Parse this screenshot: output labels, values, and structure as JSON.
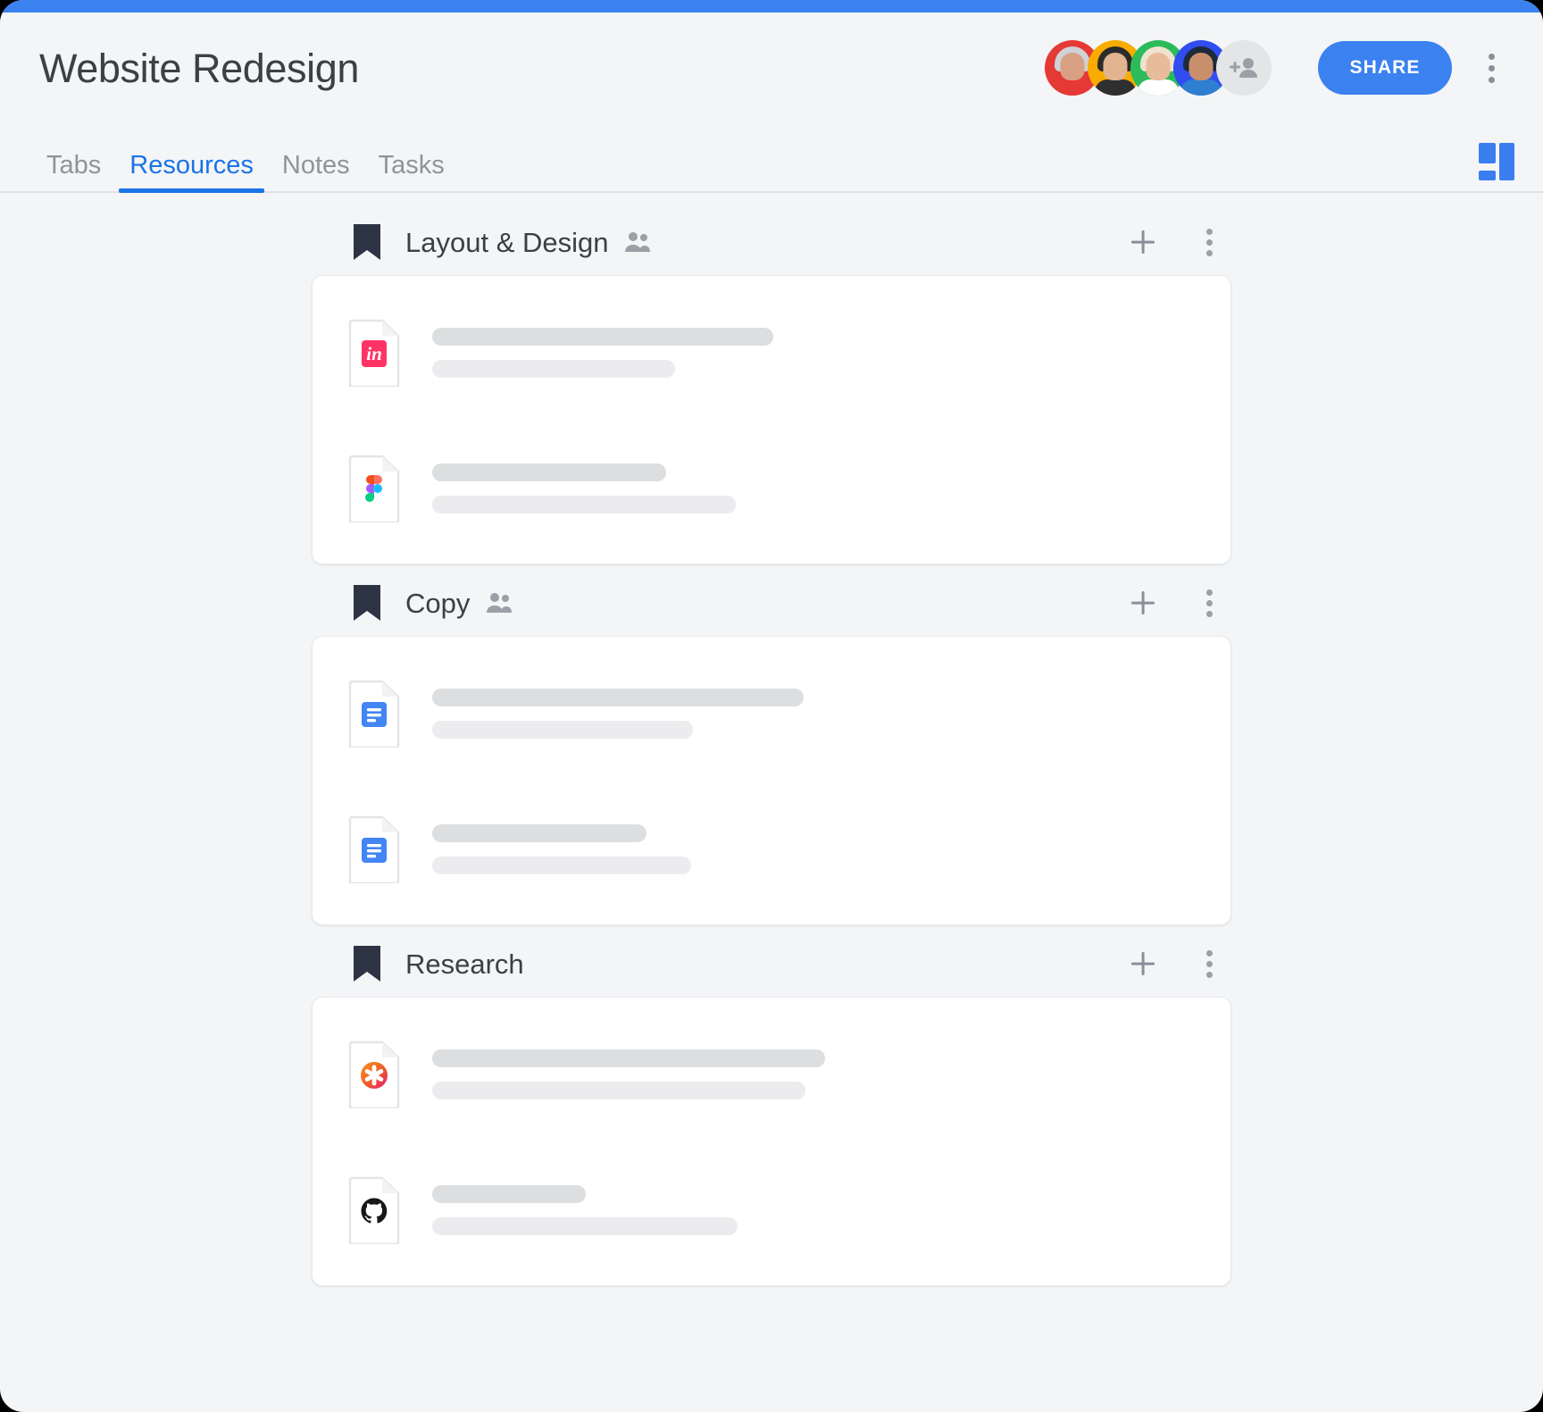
{
  "theme": {
    "accent": "#3b82f0",
    "active_tab_color": "#1a73e8",
    "page_bg": "#f3f5f7",
    "card_bg": "#ffffff",
    "bookmark_color": "#2c3444",
    "placeholder_primary": "#dddee0",
    "placeholder_secondary": "#ececee"
  },
  "header": {
    "title": "Website Redesign",
    "share_label": "SHARE",
    "overflow_icon": "kebab-menu-icon",
    "avatars": [
      {
        "name": "collaborator-1",
        "bg": "#e53935",
        "hair": "#cfd2d6",
        "skin": "#d8a183",
        "body": "#e53935"
      },
      {
        "name": "collaborator-2",
        "bg": "#f9ab00",
        "hair": "#2b2b2b",
        "skin": "#e2b48f",
        "body": "#3a3a3a"
      },
      {
        "name": "collaborator-3",
        "bg": "#2bbb5b",
        "hair": "#efe3cf",
        "skin": "#e8bb9b",
        "body": "#ffffff"
      },
      {
        "name": "collaborator-4",
        "bg": "#2f4df0",
        "hair": "#1d2a3a",
        "skin": "#c98f6c",
        "body": "#2f7fd0"
      }
    ],
    "add_people_icon": "add-people-icon"
  },
  "tabs": {
    "items": [
      {
        "label": "Tabs",
        "active": false
      },
      {
        "label": "Resources",
        "active": true
      },
      {
        "label": "Notes",
        "active": false
      },
      {
        "label": "Tasks",
        "active": false
      }
    ],
    "layout_toggle_icon": "grid-layout-icon"
  },
  "sections": [
    {
      "title": "Layout & Design",
      "bookmark_icon": "bookmark-icon",
      "shared": true,
      "shared_icon": "people-icon",
      "add_icon": "plus-icon",
      "menu_icon": "kebab-menu-icon",
      "resources": [
        {
          "icon": "invision-file-icon",
          "icon_label": "in",
          "icon_color": "#ff3366",
          "title_width": 382,
          "subtitle_width": 272
        },
        {
          "icon": "figma-file-icon",
          "icon_color": "#f24e1e",
          "title_width": 262,
          "subtitle_width": 340
        }
      ]
    },
    {
      "title": "Copy",
      "bookmark_icon": "bookmark-icon",
      "shared": true,
      "shared_icon": "people-icon",
      "add_icon": "plus-icon",
      "menu_icon": "kebab-menu-icon",
      "resources": [
        {
          "icon": "google-docs-file-icon",
          "icon_color": "#4285f4",
          "title_width": 416,
          "subtitle_width": 292
        },
        {
          "icon": "google-docs-file-icon",
          "icon_color": "#4285f4",
          "title_width": 240,
          "subtitle_width": 290
        }
      ]
    },
    {
      "title": "Research",
      "bookmark_icon": "bookmark-icon",
      "shared": false,
      "shared_icon": "people-icon",
      "add_icon": "plus-icon",
      "menu_icon": "kebab-menu-icon",
      "resources": [
        {
          "icon": "optimal-workshop-file-icon",
          "icon_color": "#f7941e",
          "title_width": 440,
          "subtitle_width": 418
        },
        {
          "icon": "github-file-icon",
          "icon_color": "#181717",
          "title_width": 172,
          "subtitle_width": 342
        }
      ]
    }
  ]
}
